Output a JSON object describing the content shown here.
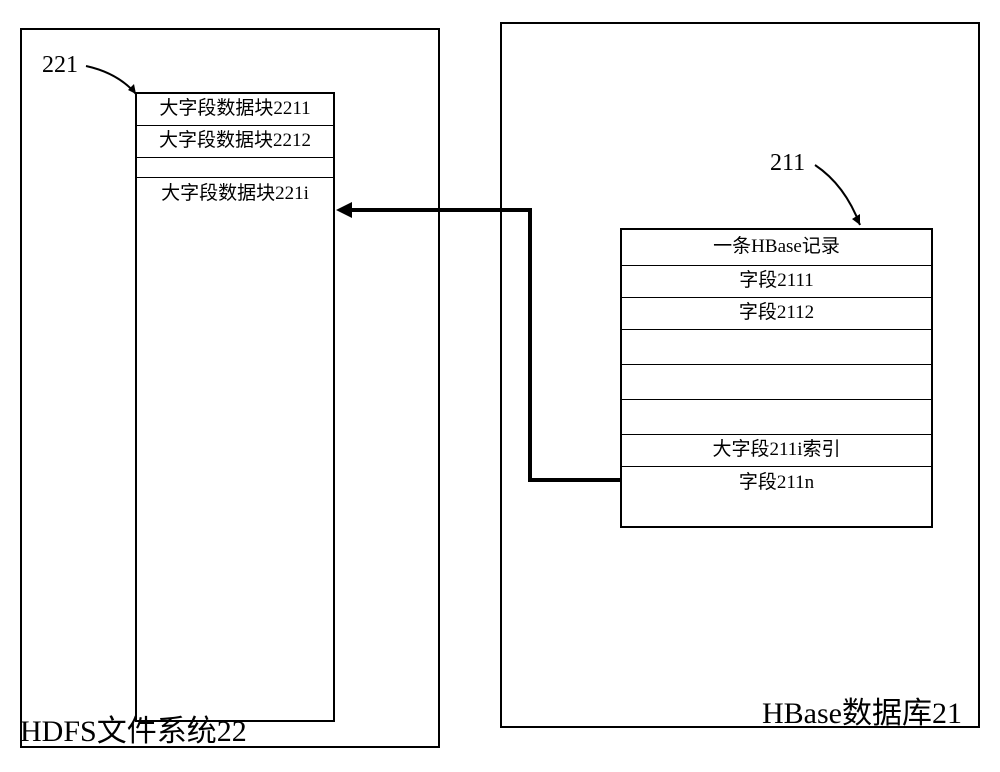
{
  "left": {
    "labelNum": "221",
    "bottomLabel": "HDFS文件系统22",
    "rows": {
      "r1": "大字段数据块2211",
      "r2": "大字段数据块2212",
      "r3": "大字段数据块221i"
    }
  },
  "right": {
    "labelNum": "211",
    "bottomLabel": "HBase数据库21",
    "rows": {
      "header": "一条HBase记录",
      "f1": "字段2111",
      "f2": "字段2112",
      "big": "大字段211i索引",
      "fn": "字段211n"
    }
  }
}
